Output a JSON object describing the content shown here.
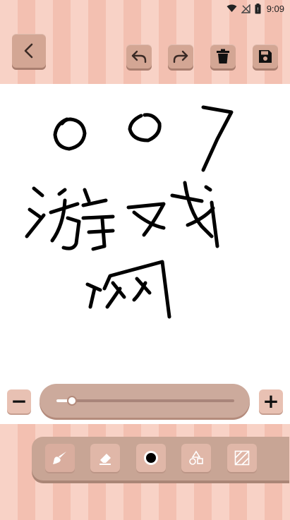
{
  "status_bar": {
    "time": "9:09",
    "icons": [
      "wifi-icon",
      "signal-icon",
      "battery-icon"
    ]
  },
  "toolbar": {
    "back": "arrow-left-icon",
    "undo": "undo-icon",
    "redo": "redo-icon",
    "delete": "trash-icon",
    "save": "save-icon"
  },
  "canvas": {
    "drawing_text": "007 游戏网",
    "stroke_color": "#000000",
    "background": "#ffffff"
  },
  "brush_size": {
    "minus": "−",
    "plus": "+",
    "value_fraction": 0.08
  },
  "tools": [
    "brush-icon",
    "eraser-icon",
    "color-dot-icon",
    "shapes-icon",
    "fill-pattern-icon"
  ],
  "colors": {
    "accent": "#d3a694",
    "stripe_light": "#f8d2c6",
    "stripe_dark": "#f3c0b1"
  }
}
